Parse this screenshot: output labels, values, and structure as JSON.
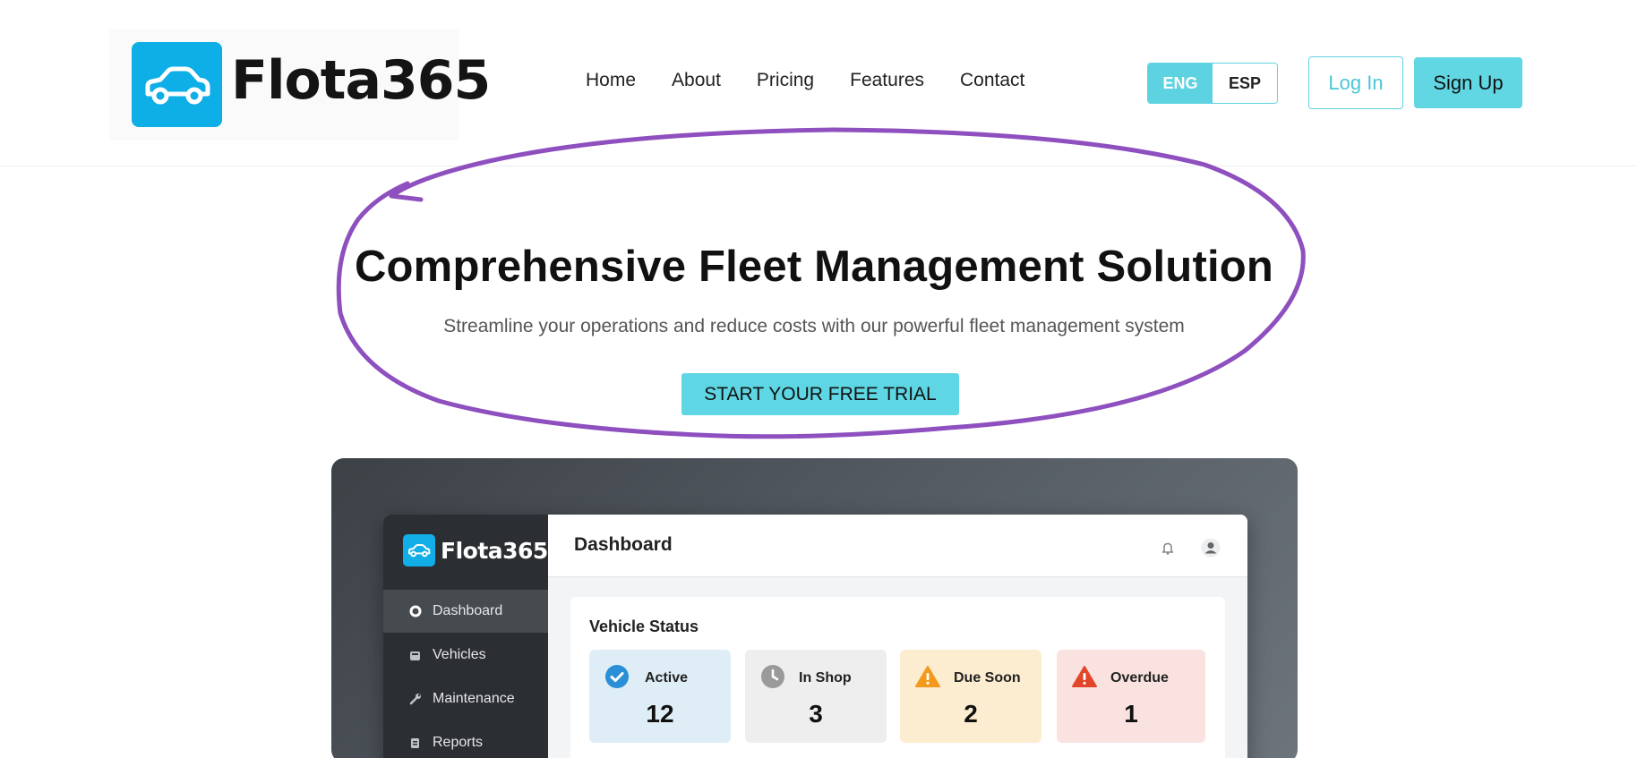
{
  "brand": {
    "name": "Flota365"
  },
  "nav": {
    "items": [
      "Home",
      "About",
      "Pricing",
      "Features",
      "Contact"
    ]
  },
  "language": {
    "options": [
      "ENG",
      "ESP"
    ],
    "active": "ENG"
  },
  "auth": {
    "login_label": "Log In",
    "signup_label": "Sign Up"
  },
  "hero": {
    "title": "Comprehensive Fleet Management Solution",
    "subtitle": "Streamline your operations and reduce costs with our powerful fleet management system",
    "cta_label": "START YOUR FREE TRIAL"
  },
  "annotation": {
    "color": "#8e4fbf"
  },
  "colors": {
    "accent": "#5fd6e3",
    "brand_blue": "#0eaee6"
  },
  "dashboard": {
    "brand_name": "Flota365",
    "title": "Dashboard",
    "sidebar": {
      "items": [
        {
          "label": "Dashboard",
          "icon": "circle-icon",
          "active": true
        },
        {
          "label": "Vehicles",
          "icon": "vehicle-icon",
          "active": false
        },
        {
          "label": "Maintenance",
          "icon": "wrench-icon",
          "active": false
        },
        {
          "label": "Reports",
          "icon": "report-icon",
          "active": false
        }
      ]
    },
    "vehicle_status": {
      "title": "Vehicle Status",
      "cards": [
        {
          "label": "Active",
          "value": "12",
          "icon": "check-circle-icon",
          "bg": "#deedf6"
        },
        {
          "label": "In Shop",
          "value": "3",
          "icon": "clock-icon",
          "bg": "#eeeeee"
        },
        {
          "label": "Due Soon",
          "value": "2",
          "icon": "warning-icon",
          "bg": "#fcecd0"
        },
        {
          "label": "Overdue",
          "value": "1",
          "icon": "alert-icon",
          "bg": "#f9e2df"
        }
      ]
    }
  }
}
